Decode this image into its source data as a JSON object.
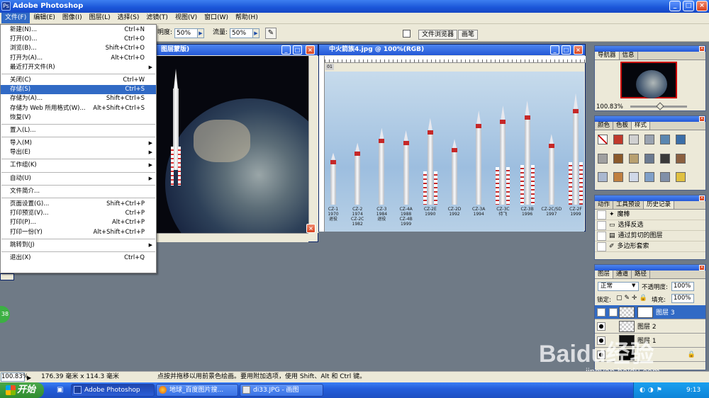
{
  "app": {
    "title": "Adobe Photoshop",
    "icon": "photoshop-icon"
  },
  "window_buttons": {
    "min": "_",
    "max": "□",
    "close": "×"
  },
  "menubar": [
    "文件(F)",
    "编辑(E)",
    "图像(I)",
    "图层(L)",
    "选择(S)",
    "滤镜(T)",
    "视图(V)",
    "窗口(W)",
    "帮助(H)"
  ],
  "options": {
    "opacity_label": "明度:",
    "opacity_value": "50%",
    "flow_label": "流量:",
    "flow_value": "50%",
    "tab_file_browser": "文件浏览器",
    "tab_brushes": "画笔"
  },
  "file_menu": [
    {
      "label": "新建(N)...",
      "shortcut": "Ctrl+N"
    },
    {
      "label": "打开(O)...",
      "shortcut": "Ctrl+O"
    },
    {
      "label": "浏览(B)...",
      "shortcut": "Shift+Ctrl+O"
    },
    {
      "label": "打开为(A)...",
      "shortcut": "Alt+Ctrl+O"
    },
    {
      "label": "最近打开文件(R)",
      "shortcut": "",
      "submenu": true
    },
    {
      "sep": true
    },
    {
      "label": "关闭(C)",
      "shortcut": "Ctrl+W"
    },
    {
      "label": "存储(S)",
      "shortcut": "Ctrl+S",
      "highlight": true
    },
    {
      "label": "存储为(A)...",
      "shortcut": "Shift+Ctrl+S"
    },
    {
      "label": "存储为 Web 所用格式(W)...",
      "shortcut": "Alt+Shift+Ctrl+S"
    },
    {
      "label": "恢复(V)",
      "shortcut": ""
    },
    {
      "sep": true
    },
    {
      "label": "置入(L)...",
      "shortcut": ""
    },
    {
      "sep": true
    },
    {
      "label": "导入(M)",
      "shortcut": "",
      "submenu": true
    },
    {
      "label": "导出(E)",
      "shortcut": "",
      "submenu": true
    },
    {
      "sep": true
    },
    {
      "label": "工作组(K)",
      "shortcut": "",
      "submenu": true
    },
    {
      "sep": true
    },
    {
      "label": "自动(U)",
      "shortcut": "",
      "submenu": true
    },
    {
      "sep": true
    },
    {
      "label": "文件简介...",
      "shortcut": ""
    },
    {
      "sep": true
    },
    {
      "label": "页面设置(G)...",
      "shortcut": "Shift+Ctrl+P"
    },
    {
      "label": "打印预览(V)...",
      "shortcut": "Ctrl+P"
    },
    {
      "label": "打印(P)...",
      "shortcut": "Alt+Ctrl+P"
    },
    {
      "label": "打印一份(Y)",
      "shortcut": "Alt+Shift+Ctrl+P"
    },
    {
      "sep": true
    },
    {
      "label": "跳转到(J)",
      "shortcut": "",
      "submenu": true
    },
    {
      "sep": true
    },
    {
      "label": "退出(X)",
      "shortcut": "Ctrl+Q"
    }
  ],
  "doc1": {
    "title": "图层蒙版)"
  },
  "doc2": {
    "title": "中火箭族4.jpg @ 100%(RGB)",
    "layer_tag": "01"
  },
  "rockets": [
    {
      "name": "CZ-1",
      "year": "1970",
      "note": "退役",
      "h": 0.42
    },
    {
      "name": "CZ-2",
      "year": "1974",
      "extra": "CZ-2C",
      "year2": "1982",
      "h": 0.5
    },
    {
      "name": "CZ-3",
      "year": "1984",
      "note": "退役",
      "h": 0.62
    },
    {
      "name": "CZ-4A",
      "year": "1988",
      "extra": "CZ-4B",
      "year2": "1999",
      "h": 0.6
    },
    {
      "name": "CZ-2E",
      "year": "1990",
      "h": 0.7
    },
    {
      "name": "CZ-2D",
      "year": "1992",
      "h": 0.53
    },
    {
      "name": "CZ-3A",
      "year": "1994",
      "h": 0.76
    },
    {
      "name": "CZ-3C",
      "year": "待飞",
      "h": 0.8
    },
    {
      "name": "CZ-3B",
      "year": "1996",
      "h": 0.84
    },
    {
      "name": "CZ-2C/SD",
      "year": "1997",
      "h": 0.57
    },
    {
      "name": "CZ-2F",
      "year": "1999",
      "h": 0.9
    }
  ],
  "navigator": {
    "tabs": [
      "导航器",
      "信息"
    ],
    "zoom": "100.83%"
  },
  "swatches": {
    "tabs": [
      "颜色",
      "色板",
      "样式"
    ],
    "colors": [
      "#ffffff",
      "#c0392b",
      "#d0d0d0",
      "#9aa3b0",
      "#5a86b0",
      "#3b6ea8",
      "#a0a0a0",
      "#8b5a2b",
      "#b8a070",
      "#6b7a90",
      "#3a3a3a",
      "#8b6040",
      "#aab8d0",
      "#c08040",
      "#d0d8e8",
      "#80a0c8",
      "#8090a8",
      "#e0c040"
    ]
  },
  "history": {
    "tabs": [
      "动作",
      "工具预设",
      "历史记录"
    ],
    "items": [
      "魔棒",
      "选择反选",
      "通过剪切的图层",
      "多边形套索"
    ]
  },
  "layers": {
    "tabs": [
      "图层",
      "通道",
      "路径"
    ],
    "blend": "正常",
    "opacity_label": "不透明度:",
    "opacity": "100%",
    "lock_label": "锁定:",
    "fill_label": "填充:",
    "fill": "100%",
    "items": [
      "图层 3",
      "图层 2",
      "图层 1"
    ]
  },
  "status": {
    "zoom": "100.83%",
    "size": "176.39 毫米 x 114.3 毫米",
    "hint": "点按并拖移以用前景色绘画。要用附加选项，使用 Shift、Alt 和 Ctrl 键。"
  },
  "taskbar": {
    "start": "开始",
    "items": [
      "Adobe Photoshop",
      "地球_百度图片搜...",
      "di33.JPG - 画图"
    ],
    "clock": "9:13"
  },
  "watermark": {
    "brand": "Baidu经验",
    "url": "jingyan.baidu.com"
  },
  "badge": "38"
}
